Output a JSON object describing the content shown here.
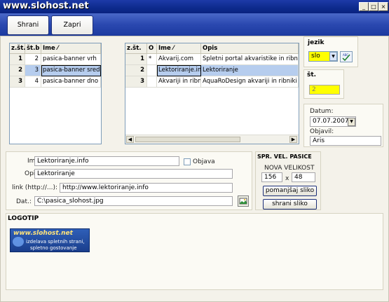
{
  "window": {
    "title": "www.slohost.net"
  },
  "toolbar": {
    "save_label": "Shrani",
    "close_label": "Zapri"
  },
  "left_grid": {
    "headers": [
      "z.št.",
      "št.b",
      "Ime"
    ],
    "rows": [
      {
        "num": "1",
        "stb": "2",
        "ime": "pasica-banner vrh"
      },
      {
        "num": "2",
        "stb": "3",
        "ime": "pasica-banner sredina"
      },
      {
        "num": "3",
        "stb": "4",
        "ime": "pasica-banner dno"
      }
    ]
  },
  "right_grid": {
    "headers": [
      "z.št.",
      "O",
      "Ime",
      "Opis"
    ],
    "rows": [
      {
        "num": "1",
        "o": "*",
        "ime": "Akvarij.com",
        "opis": "Spletni portal akvaristike in ribniške opr"
      },
      {
        "num": "2",
        "o": "",
        "ime": "Lektoriranje.info",
        "opis": "Lektoriranje"
      },
      {
        "num": "3",
        "o": "",
        "ime": "Akvariji in ribniki",
        "opis": "AquaRoDesign akvariji in ribniki"
      }
    ]
  },
  "jezik": {
    "label": "jezik",
    "value": "slo"
  },
  "st": {
    "label": "št.",
    "value": "2"
  },
  "meta": {
    "datum_label": "Datum:",
    "datum_value": "07.07.2007",
    "objavil_label": "Objavil:",
    "objavil_value": "Aris"
  },
  "form": {
    "ime_label": "Ime:",
    "ime_value": "Lektoriranje.info",
    "objava_label": "Objava",
    "opis_label": "Opis:",
    "opis_value": "Lektoriranje",
    "link_label": "link (http://...):",
    "link_value": "http://www.lektoriranje.info",
    "dat_label": "Dat.:",
    "dat_value": "C:\\pasica_slohost.jpg"
  },
  "resize": {
    "title": "SPR. VEL. PASICE",
    "subtitle": "NOVA VELIKOST",
    "width": "156",
    "x_label": "x",
    "height": "48",
    "shrink_label": "pomanjšaj sliko",
    "save_label": "shrani sliko"
  },
  "logotip": {
    "label": "LOGOTIP",
    "logo_title": "www.slohost.net",
    "logo_line1": "izdelava spletnih strani,",
    "logo_line2": "spletno gostovanje"
  },
  "colors": {
    "titlebar": "#0d2a8c",
    "selection": "#b6cdee",
    "highlight": "#ffff00"
  }
}
